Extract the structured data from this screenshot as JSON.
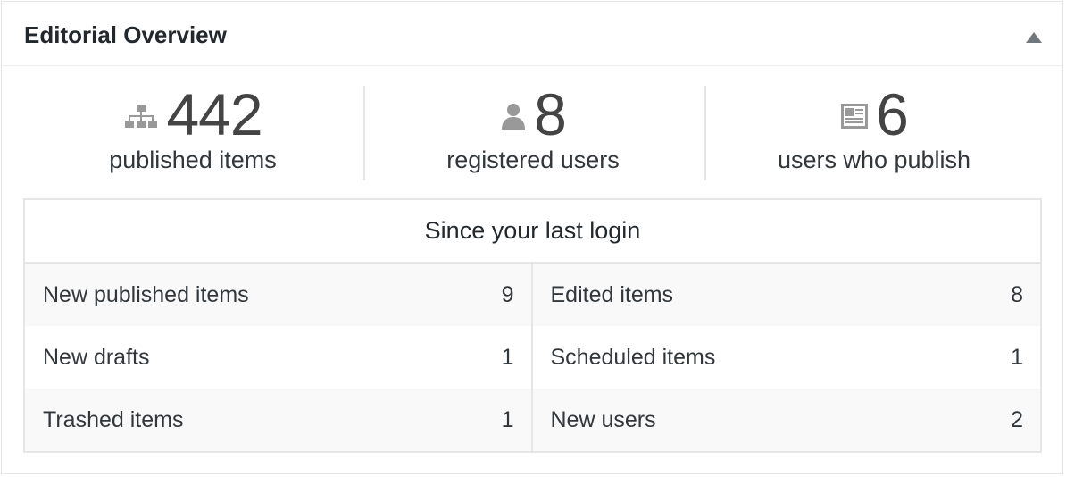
{
  "widget": {
    "title": "Editorial Overview",
    "toggle_icon": "triangle-up-icon"
  },
  "stats": [
    {
      "icon": "sitemap-icon",
      "value": "442",
      "label": "published items"
    },
    {
      "icon": "user-icon",
      "value": "8",
      "label": "registered users"
    },
    {
      "icon": "id-card-icon",
      "value": "6",
      "label": "users who publish"
    }
  ],
  "since": {
    "title": "Since your last login",
    "left": [
      {
        "label": "New published items",
        "value": "9"
      },
      {
        "label": "New drafts",
        "value": "1"
      },
      {
        "label": "Trashed items",
        "value": "1"
      }
    ],
    "right": [
      {
        "label": "Edited items",
        "value": "8"
      },
      {
        "label": "Scheduled items",
        "value": "1"
      },
      {
        "label": "New users",
        "value": "2"
      }
    ]
  },
  "colors": {
    "icon": "#999999",
    "border": "#e6e6e6",
    "row_shade": "#f9f9f9",
    "text": "#32373c"
  }
}
